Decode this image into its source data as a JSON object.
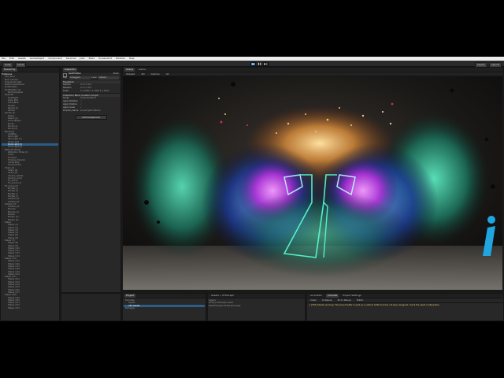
{
  "menubar": [
    "File",
    "Edit",
    "Assets",
    "GameObject",
    "Component",
    "Services",
    "Jobs",
    "Build",
    "Screenshot",
    "Window",
    "Help"
  ],
  "toolbar": {
    "account": "Unity",
    "collab": "Cloud",
    "layers": "Layers",
    "layout": "Layout"
  },
  "hierarchy": {
    "tab": "Hierarchy",
    "root": "TrialScene",
    "rows": [
      "VFX_Swirl",
      "Main Camera",
      "Directional Light",
      "PostProcessVolume",
      "FluidEmitter",
      "FluidEmitter (1)",
      "ParticleSystem",
      "SwirlLeft",
      "SwirlRight",
      "Glow_Pink",
      "Glow_Blue",
      "Sparks",
      "Sparks (1)",
      "Smoke",
      "Smoke (1)",
      "Debris",
      "Debris (1)",
      "GroundPlane",
      "Rocks",
      "Rocks (1)",
      "Rocks (2)",
      "Backdrop",
      "LightRig",
      "Spot Light",
      "Spot Light (1)",
      "Point Light",
      "Point Light (1)",
      "Point Light (2)",
      "ReflectionProbe",
      "Reflection Probe (1)",
      "Audio",
      "Timeline",
      "Timeline Director",
      "CameraRig",
      "Cinemachine",
      "VCam_01",
      "VCam_02",
      "VCam_03",
      "Volume_Global",
      "Volume_Local",
      "FX_Group",
      "FX_Group (1)",
      "FX_Group (2)",
      "Emitter_A",
      "Emitter_B",
      "Emitter_C",
      "Emitter_D",
      "Collider_01",
      "Collider_02",
      "Collider_03",
      "Collider_04",
      "Bounds",
      "Bounds (1)",
      "Marker",
      "Marker (1)",
      "Marker (2)",
      "Helper",
      "Helper (1)",
      "Helper (2)",
      "Helper (3)",
      "Helper (4)",
      "Helper (5)",
      "Helper (6)",
      "Helper (7)",
      "Helper (8)",
      "Helper (9)",
      "Helper (10)",
      "Helper (11)",
      "Helper (12)",
      "Helper (13)",
      "Helper (14)",
      "Helper (15)",
      "Helper (16)",
      "Helper (17)",
      "Helper (18)",
      "Helper (19)",
      "Helper (20)",
      "Helper (21)",
      "Helper (22)",
      "Helper (23)",
      "Helper (24)",
      "Helper (25)",
      "Helper (26)",
      "Helper (27)",
      "Helper (28)",
      "Helper (29)",
      "Helper (30)",
      "Helper (31)",
      "Helper (32)",
      "Helper (33)"
    ],
    "selected_index": 26
  },
  "inspector": {
    "tab": "Inspector",
    "object_name": "SwirlEmitter",
    "static": "Static",
    "tag_label": "Tag",
    "tag_value": "Untagged",
    "layer_label": "Layer",
    "layer_value": "Default",
    "transform_title": "Transform",
    "fields": [
      {
        "k": "Position",
        "v": "X 0   Y 0   Z 0"
      },
      {
        "k": "Rotation",
        "v": "X 0   Y 0   Z 0"
      },
      {
        "k": "Scale",
        "v": "X 1.5000  Y 1.5000  Z 1.5000"
      }
    ],
    "component_title": "Collection Block (Custom Script)",
    "component_fields": [
      {
        "k": "Script",
        "v": "CollectionBlock"
      },
      {
        "k": "Apply Rotation",
        "v": "✓"
      },
      {
        "k": "Apply Position",
        "v": "✓"
      },
      {
        "k": "Apply Scale",
        "v": "✓"
      },
      {
        "k": "Property Name",
        "v": "propertyBlockName"
      }
    ],
    "add_component": "Add Component"
  },
  "scene_tabs": {
    "scene": "Scene",
    "game": "Game"
  },
  "scene_controls": [
    "Shaded",
    "2D",
    "Gizmos",
    "All"
  ],
  "bottom_left": {
    "tabs": [
      "Project"
    ],
    "rows": [
      "Favorites",
      "Assets",
      "VFX Assets",
      "Packages"
    ]
  },
  "bottom_mid": {
    "path": "Assets > VFXGraph",
    "rows": [
      "Legacy",
      "Library VFXGraph Asset",
      "NewVFXGraph VFXGraph Asset"
    ]
  },
  "console": {
    "tabs": [
      "Animation",
      "Console",
      "Project Settings"
    ],
    "buttons": [
      "Clear",
      "Collapse",
      "Error Pause",
      "Editor"
    ],
    "line": "[VFX] Shader warning: The bound buffer is read as a uniform buffer but has not been assigned; check the asset configuration"
  },
  "colors": {
    "accent": "#3a79bb",
    "selection": "#2c5d87",
    "watermark": "#1fa6e0"
  }
}
